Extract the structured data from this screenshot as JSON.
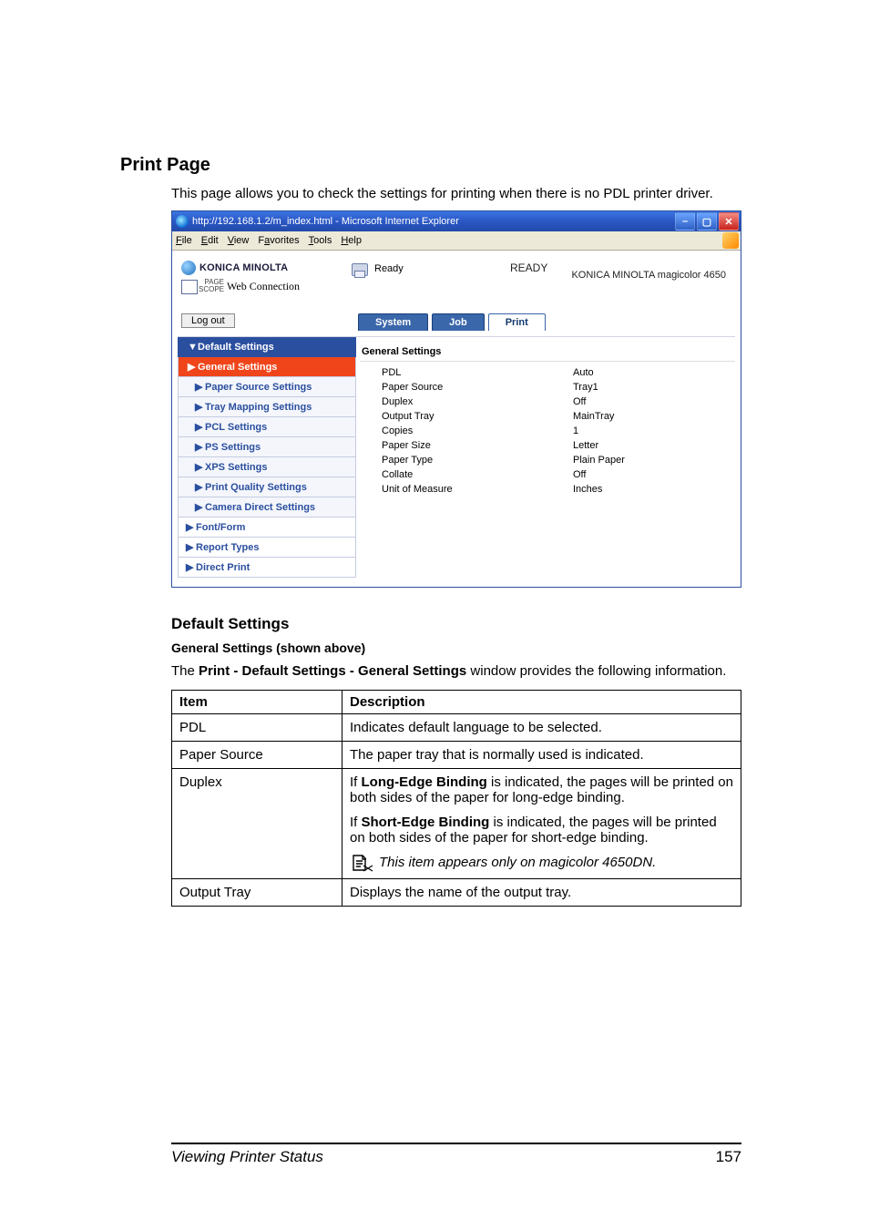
{
  "doc": {
    "section_title": "Print Page",
    "intro": "This page allows you to check the settings for printing when there is no PDL printer driver."
  },
  "ie": {
    "title": "http://192.168.1.2/m_index.html - Microsoft Internet Explorer",
    "menu": {
      "file": "File",
      "edit": "Edit",
      "view": "View",
      "favorites": "Favorites",
      "tools": "Tools",
      "help": "Help"
    },
    "brand": "KONICA MINOLTA",
    "pagescope_small_top": "PAGE",
    "pagescope_small_bottom": "SCOPE",
    "pagescope_label": "Web Connection",
    "status_label": "Ready",
    "ready": "READY",
    "device_name": "KONICA MINOLTA magicolor 4650",
    "logout": "Log out",
    "tabs": {
      "system": "System",
      "job": "Job",
      "print": "Print"
    },
    "sidebar": {
      "default_settings": "Default Settings",
      "general_settings": "General Settings",
      "paper_source_settings": "Paper Source Settings",
      "tray_mapping_settings": "Tray Mapping Settings",
      "pcl_settings": "PCL Settings",
      "ps_settings": "PS Settings",
      "xps_settings": "XPS Settings",
      "print_quality_settings": "Print Quality Settings",
      "camera_direct_settings": "Camera Direct Settings",
      "font_form": "Font/Form",
      "report_types": "Report Types",
      "direct_print": "Direct Print"
    },
    "pane": {
      "title": "General Settings",
      "rows": [
        {
          "k": "PDL",
          "v": "Auto"
        },
        {
          "k": "Paper Source",
          "v": "Tray1"
        },
        {
          "k": "Duplex",
          "v": "Off"
        },
        {
          "k": "Output Tray",
          "v": "MainTray"
        },
        {
          "k": "Copies",
          "v": "1"
        },
        {
          "k": "Paper Size",
          "v": "Letter"
        },
        {
          "k": "Paper Type",
          "v": "Plain Paper"
        },
        {
          "k": "Collate",
          "v": "Off"
        },
        {
          "k": "Unit of Measure",
          "v": "Inches"
        }
      ]
    }
  },
  "section2": {
    "title": "Default Settings",
    "subtitle": "General Settings (shown above)",
    "lead_a": "The ",
    "lead_b": "Print - Default Settings - General Settings",
    "lead_c": " window provides the following information."
  },
  "table": {
    "h1": "Item",
    "h2": "Description",
    "r1c1": "PDL",
    "r1c2": "Indicates default language to be selected.",
    "r2c1": "Paper Source",
    "r2c2": "The paper tray that is normally used is indicated.",
    "r3c1": "Duplex",
    "r3p1a": "If ",
    "r3p1b": "Long-Edge Binding",
    "r3p1c": " is indicated, the pages will be printed on both sides of the paper for long-edge binding.",
    "r3p2a": "If ",
    "r3p2b": "Short-Edge Binding",
    "r3p2c": " is indicated, the pages will be printed on both sides of the paper for short-edge binding.",
    "r3note": "This item appears only on magicolor 4650DN.",
    "r4c1": "Output Tray",
    "r4c2": "Displays the name of the output tray."
  },
  "footer": {
    "left": "Viewing Printer Status",
    "right": "157"
  }
}
